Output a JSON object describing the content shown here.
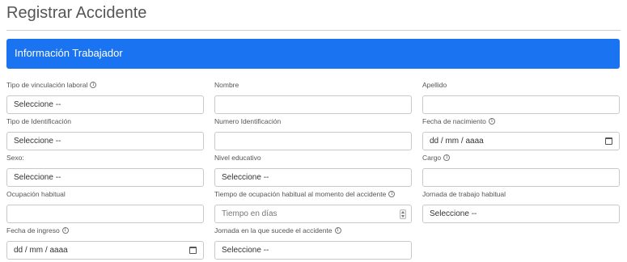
{
  "page": {
    "title": "Registrar Accidente"
  },
  "section": {
    "title": "Información Trabajador"
  },
  "fields": {
    "tipo_vinculacion": {
      "label": "Tipo de vinculación laboral",
      "value": "Seleccione --"
    },
    "nombre": {
      "label": "Nombre",
      "value": ""
    },
    "apellido": {
      "label": "Apellido",
      "value": ""
    },
    "tipo_identificacion": {
      "label": "Tipo de Identificación",
      "value": "Seleccione --"
    },
    "numero_identificacion": {
      "label": "Numero Identificación",
      "value": ""
    },
    "fecha_nacimiento": {
      "label": "Fecha de nacimiento",
      "placeholder": "dd / mm / aaaa"
    },
    "sexo": {
      "label": "Sexo:",
      "value": "Seleccione --"
    },
    "nivel_educativo": {
      "label": "Nivel educativo",
      "value": "Seleccione --"
    },
    "cargo": {
      "label": "Cargo",
      "value": ""
    },
    "ocupacion_habitual": {
      "label": "Ocupación habitual",
      "value": ""
    },
    "tiempo_ocupacion": {
      "label": "Tiempo de ocupación habitual al momento del accidente",
      "placeholder": "Tiempo en días"
    },
    "jornada_trabajo": {
      "label": "Jornada de trabajo habitual",
      "value": "Seleccione --"
    },
    "fecha_ingreso": {
      "label": "Fecha de ingreso",
      "placeholder": "dd / mm / aaaa"
    },
    "jornada_accidente": {
      "label": "Jornada en la que sucede el accidente",
      "value": "Seleccione --"
    }
  },
  "icons": {
    "info": "info-circle-icon",
    "calendar": "calendar-icon",
    "spinner": "number-spinner-icon"
  },
  "colors": {
    "section_header": "#1a73f0"
  }
}
